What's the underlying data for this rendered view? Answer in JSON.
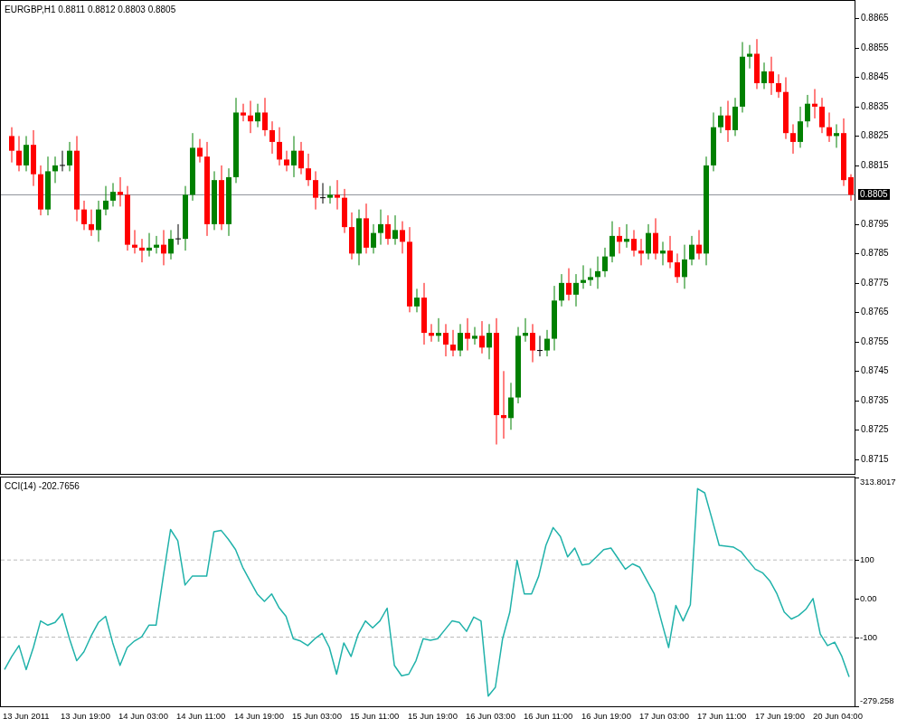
{
  "price_pane": {
    "symbol_info": "EURGBP,H1  0.8811 0.8812 0.8803 0.8805",
    "chart_data": {
      "type": "candlestick",
      "ylim": [
        0.871,
        0.8871
      ],
      "ref_lines": [
        {
          "axis": "y",
          "value": 0.8805,
          "label": "0.8805"
        }
      ],
      "yticks": [
        {
          "value": 0.8865,
          "label": "0.8865"
        },
        {
          "value": 0.8855,
          "label": "0.8855"
        },
        {
          "value": 0.8845,
          "label": "0.8845"
        },
        {
          "value": 0.8835,
          "label": "0.8835"
        },
        {
          "value": 0.8825,
          "label": "0.8825"
        },
        {
          "value": 0.8815,
          "label": "0.8815"
        },
        {
          "value": 0.8795,
          "label": "0.8795"
        },
        {
          "value": 0.8785,
          "label": "0.8785"
        },
        {
          "value": 0.8775,
          "label": "0.8775"
        },
        {
          "value": 0.8765,
          "label": "0.8765"
        },
        {
          "value": 0.8755,
          "label": "0.8755"
        },
        {
          "value": 0.8745,
          "label": "0.8745"
        },
        {
          "value": 0.8735,
          "label": "0.8735"
        },
        {
          "value": 0.8725,
          "label": "0.8725"
        },
        {
          "value": 0.8715,
          "label": "0.8715"
        }
      ],
      "ohlc": [
        [
          0.8825,
          0.8828,
          0.8816,
          0.882
        ],
        [
          0.882,
          0.8825,
          0.8813,
          0.8815
        ],
        [
          0.8815,
          0.8825,
          0.8813,
          0.8822
        ],
        [
          0.8822,
          0.8827,
          0.8808,
          0.8812
        ],
        [
          0.8812,
          0.8815,
          0.8798,
          0.88
        ],
        [
          0.88,
          0.8818,
          0.8798,
          0.8813
        ],
        [
          0.8813,
          0.8818,
          0.8809,
          0.8815
        ],
        [
          0.8815,
          0.882,
          0.8813,
          0.8815
        ],
        [
          0.8815,
          0.8823,
          0.8813,
          0.882
        ],
        [
          0.882,
          0.8825,
          0.8796,
          0.88
        ],
        [
          0.88,
          0.8803,
          0.8793,
          0.8795
        ],
        [
          0.8795,
          0.88,
          0.8791,
          0.8793
        ],
        [
          0.8793,
          0.8803,
          0.8789,
          0.88
        ],
        [
          0.88,
          0.8808,
          0.8798,
          0.8803
        ],
        [
          0.8803,
          0.8809,
          0.8801,
          0.8806
        ],
        [
          0.8806,
          0.8811,
          0.8801,
          0.8805
        ],
        [
          0.8805,
          0.8808,
          0.8786,
          0.8788
        ],
        [
          0.8788,
          0.8793,
          0.8785,
          0.8787
        ],
        [
          0.8787,
          0.879,
          0.8782,
          0.8786
        ],
        [
          0.8786,
          0.8792,
          0.8784,
          0.8787
        ],
        [
          0.8787,
          0.8791,
          0.8785,
          0.8788
        ],
        [
          0.8788,
          0.8793,
          0.8781,
          0.8785
        ],
        [
          0.8785,
          0.8793,
          0.8783,
          0.879
        ],
        [
          0.879,
          0.8795,
          0.8788,
          0.879
        ],
        [
          0.879,
          0.8808,
          0.8786,
          0.8805
        ],
        [
          0.8805,
          0.8826,
          0.8803,
          0.8821
        ],
        [
          0.8821,
          0.8824,
          0.8816,
          0.8818
        ],
        [
          0.8818,
          0.8823,
          0.8791,
          0.8795
        ],
        [
          0.8795,
          0.8813,
          0.8793,
          0.881
        ],
        [
          0.881,
          0.8815,
          0.8793,
          0.8795
        ],
        [
          0.8795,
          0.8814,
          0.8791,
          0.8811
        ],
        [
          0.8811,
          0.8838,
          0.8809,
          0.8833
        ],
        [
          0.8833,
          0.8836,
          0.883,
          0.8832
        ],
        [
          0.8832,
          0.8837,
          0.8826,
          0.883
        ],
        [
          0.883,
          0.8836,
          0.8828,
          0.8833
        ],
        [
          0.8833,
          0.8838,
          0.8825,
          0.8827
        ],
        [
          0.8827,
          0.883,
          0.8819,
          0.8823
        ],
        [
          0.8823,
          0.8828,
          0.8815,
          0.8817
        ],
        [
          0.8817,
          0.882,
          0.8813,
          0.8815
        ],
        [
          0.8815,
          0.8825,
          0.8811,
          0.882
        ],
        [
          0.882,
          0.8823,
          0.8812,
          0.8814
        ],
        [
          0.8814,
          0.8819,
          0.8808,
          0.881
        ],
        [
          0.881,
          0.8813,
          0.88,
          0.8804
        ],
        [
          0.8804,
          0.8809,
          0.8802,
          0.8804
        ],
        [
          0.8804,
          0.8808,
          0.8802,
          0.8805
        ],
        [
          0.8805,
          0.881,
          0.88,
          0.8804
        ],
        [
          0.8804,
          0.8807,
          0.8792,
          0.8794
        ],
        [
          0.8794,
          0.8799,
          0.8783,
          0.8785
        ],
        [
          0.8785,
          0.88,
          0.8781,
          0.8797
        ],
        [
          0.8797,
          0.8802,
          0.8785,
          0.8787
        ],
        [
          0.8787,
          0.8795,
          0.8785,
          0.8792
        ],
        [
          0.8792,
          0.88,
          0.8788,
          0.8795
        ],
        [
          0.8795,
          0.8798,
          0.8788,
          0.879
        ],
        [
          0.879,
          0.8798,
          0.8788,
          0.8793
        ],
        [
          0.8793,
          0.8796,
          0.8785,
          0.8789
        ],
        [
          0.8789,
          0.8794,
          0.8765,
          0.8767
        ],
        [
          0.8767,
          0.8773,
          0.8765,
          0.877
        ],
        [
          0.877,
          0.8775,
          0.8754,
          0.8758
        ],
        [
          0.8758,
          0.8761,
          0.8755,
          0.8757
        ],
        [
          0.8757,
          0.8763,
          0.8755,
          0.8758
        ],
        [
          0.8758,
          0.8761,
          0.875,
          0.8754
        ],
        [
          0.8754,
          0.8759,
          0.875,
          0.8752
        ],
        [
          0.8752,
          0.8761,
          0.875,
          0.8758
        ],
        [
          0.8758,
          0.8763,
          0.8752,
          0.8756
        ],
        [
          0.8756,
          0.876,
          0.8754,
          0.8757
        ],
        [
          0.8757,
          0.8762,
          0.8751,
          0.8753
        ],
        [
          0.8753,
          0.8761,
          0.8749,
          0.8758
        ],
        [
          0.8758,
          0.8763,
          0.872,
          0.873
        ],
        [
          0.873,
          0.8745,
          0.8722,
          0.8729
        ],
        [
          0.8729,
          0.8741,
          0.8725,
          0.8736
        ],
        [
          0.8736,
          0.876,
          0.8734,
          0.8757
        ],
        [
          0.8757,
          0.8763,
          0.8755,
          0.8758
        ],
        [
          0.8758,
          0.8761,
          0.8748,
          0.8752
        ],
        [
          0.8752,
          0.8757,
          0.875,
          0.8752
        ],
        [
          0.8752,
          0.8759,
          0.875,
          0.8756
        ],
        [
          0.8756,
          0.8774,
          0.8752,
          0.8769
        ],
        [
          0.8769,
          0.8778,
          0.8767,
          0.8775
        ],
        [
          0.8775,
          0.878,
          0.8769,
          0.8771
        ],
        [
          0.8771,
          0.8778,
          0.8767,
          0.8775
        ],
        [
          0.8775,
          0.8781,
          0.8773,
          0.8776
        ],
        [
          0.8776,
          0.878,
          0.8774,
          0.8777
        ],
        [
          0.8777,
          0.8784,
          0.8773,
          0.8779
        ],
        [
          0.8779,
          0.8787,
          0.8777,
          0.8784
        ],
        [
          0.8784,
          0.8796,
          0.8782,
          0.8791
        ],
        [
          0.8791,
          0.8794,
          0.8785,
          0.8789
        ],
        [
          0.8789,
          0.8795,
          0.8787,
          0.879
        ],
        [
          0.879,
          0.8793,
          0.8784,
          0.8786
        ],
        [
          0.8786,
          0.879,
          0.8781,
          0.8785
        ],
        [
          0.8785,
          0.8795,
          0.8783,
          0.8792
        ],
        [
          0.8792,
          0.8797,
          0.8783,
          0.8785
        ],
        [
          0.8785,
          0.8789,
          0.8781,
          0.8786
        ],
        [
          0.8786,
          0.8791,
          0.878,
          0.8782
        ],
        [
          0.8782,
          0.8785,
          0.8775,
          0.8777
        ],
        [
          0.8777,
          0.8788,
          0.8773,
          0.8783
        ],
        [
          0.8783,
          0.8791,
          0.8781,
          0.8788
        ],
        [
          0.8788,
          0.8793,
          0.8783,
          0.8785
        ],
        [
          0.8785,
          0.8818,
          0.8781,
          0.8815
        ],
        [
          0.8815,
          0.8833,
          0.8813,
          0.8828
        ],
        [
          0.8828,
          0.8835,
          0.8826,
          0.8832
        ],
        [
          0.8832,
          0.8837,
          0.8823,
          0.8827
        ],
        [
          0.8827,
          0.8838,
          0.8825,
          0.8835
        ],
        [
          0.8835,
          0.8857,
          0.8833,
          0.8852
        ],
        [
          0.8852,
          0.8856,
          0.8848,
          0.8853
        ],
        [
          0.8853,
          0.8858,
          0.8841,
          0.8843
        ],
        [
          0.8843,
          0.885,
          0.8841,
          0.8847
        ],
        [
          0.8847,
          0.8852,
          0.8839,
          0.8843
        ],
        [
          0.8843,
          0.8846,
          0.8838,
          0.884
        ],
        [
          0.884,
          0.8845,
          0.8824,
          0.8826
        ],
        [
          0.8826,
          0.8829,
          0.8819,
          0.8823
        ],
        [
          0.8823,
          0.8835,
          0.8821,
          0.883
        ],
        [
          0.883,
          0.8839,
          0.8828,
          0.8836
        ],
        [
          0.8836,
          0.8841,
          0.8831,
          0.8835
        ],
        [
          0.8835,
          0.8838,
          0.8826,
          0.8828
        ],
        [
          0.8828,
          0.8833,
          0.8823,
          0.8825
        ],
        [
          0.8825,
          0.8829,
          0.8821,
          0.8826
        ],
        [
          0.8826,
          0.8831,
          0.8808,
          0.881
        ],
        [
          0.8811,
          0.8812,
          0.8803,
          0.8805
        ]
      ]
    }
  },
  "indicator_pane": {
    "reading": "-202.7656",
    "chart_data": {
      "type": "line",
      "ylim": [
        -279.258,
        313.8017
      ],
      "yticks": [
        {
          "value": 313.8017,
          "label": "313.8017"
        },
        {
          "value": 100,
          "label": "100"
        },
        {
          "value": 0,
          "label": "0.00"
        },
        {
          "value": -100,
          "label": "-100"
        },
        {
          "value": -279.258,
          "label": "-279.258"
        }
      ],
      "series": [
        {
          "name": "CCI(14)",
          "color": "#20b2aa",
          "values": [
            -184,
            -150,
            -122,
            -184,
            -127,
            -58,
            -69,
            -62,
            -39,
            -104,
            -161,
            -138,
            -97,
            -62,
            -46,
            -115,
            -173,
            -127,
            -110,
            -99,
            -69,
            -69,
            58,
            179,
            150,
            35,
            58,
            58,
            58,
            173,
            177,
            154,
            127,
            81,
            46,
            12,
            -7,
            12,
            -23,
            -46,
            -104,
            -110,
            -122,
            -104,
            -90,
            -127,
            -196,
            -115,
            -150,
            -92,
            -58,
            -76,
            -58,
            -25,
            -173,
            -200,
            -196,
            -161,
            -104,
            -108,
            -104,
            -81,
            -58,
            -62,
            -85,
            -48,
            -58,
            -253,
            -230,
            -104,
            -35,
            99,
            12,
            12,
            58,
            138,
            184,
            161,
            108,
            131,
            87,
            90,
            108,
            127,
            131,
            104,
            76,
            90,
            81,
            46,
            12,
            -58,
            -127,
            -18,
            -58,
            -16,
            285,
            274,
            207,
            138,
            136,
            133,
            122,
            99,
            76,
            67,
            46,
            12,
            -35,
            -53,
            -44,
            -28,
            0,
            -92,
            -122,
            -113,
            -150,
            -203
          ]
        }
      ]
    }
  },
  "time_axis": [
    "13 Jun 2011",
    "13 Jun 19:00",
    "14 Jun 03:00",
    "14 Jun 11:00",
    "14 Jun 19:00",
    "15 Jun 03:00",
    "15 Jun 11:00",
    "15 Jun 19:00",
    "16 Jun 03:00",
    "16 Jun 11:00",
    "16 Jun 19:00",
    "17 Jun 03:00",
    "17 Jun 11:00",
    "17 Jun 19:00",
    "20 Jun 04:00"
  ]
}
